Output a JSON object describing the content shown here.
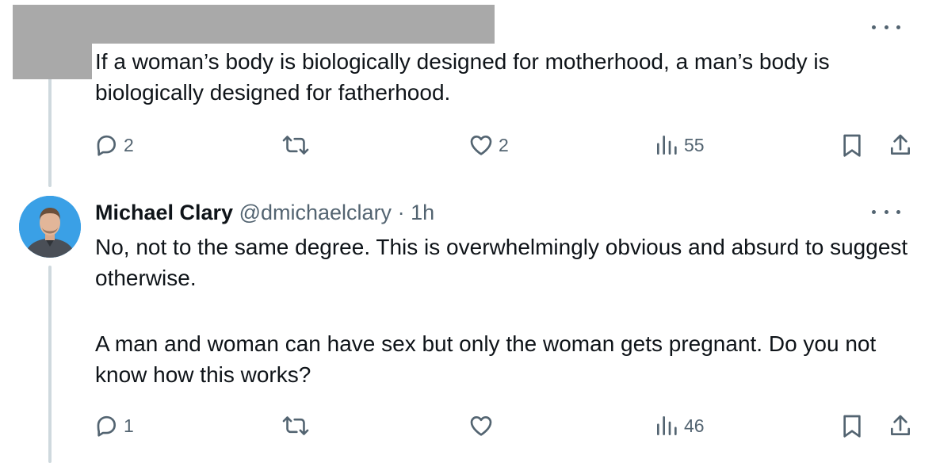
{
  "tweets": [
    {
      "text": "If a woman’s body is biologically designed for motherhood, a man’s body is biologically designed for fatherhood.",
      "actions": {
        "replies": "2",
        "retweets": "",
        "likes": "2",
        "views": "55"
      }
    },
    {
      "author": {
        "name": "Michael Clary",
        "handle": "@dmichaelclary",
        "separator": "·",
        "time": "1h"
      },
      "text_p1": "No, not to the same degree. This is overwhelmingly obvious and absurd to suggest otherwise.",
      "text_p2": "A man and woman can have sex but only the woman gets pregnant. Do you not know how this works?",
      "actions": {
        "replies": "1",
        "retweets": "",
        "likes": "",
        "views": "46"
      }
    }
  ],
  "colors": {
    "muted": "#536471",
    "text": "#0f1419",
    "thread_line": "#cfd9de",
    "redaction": "#a9a9a9",
    "avatar_bg": "#3aa0e6"
  },
  "icons": [
    "more-icon",
    "reply-icon",
    "retweet-icon",
    "like-icon",
    "views-icon",
    "bookmark-icon",
    "share-icon"
  ]
}
